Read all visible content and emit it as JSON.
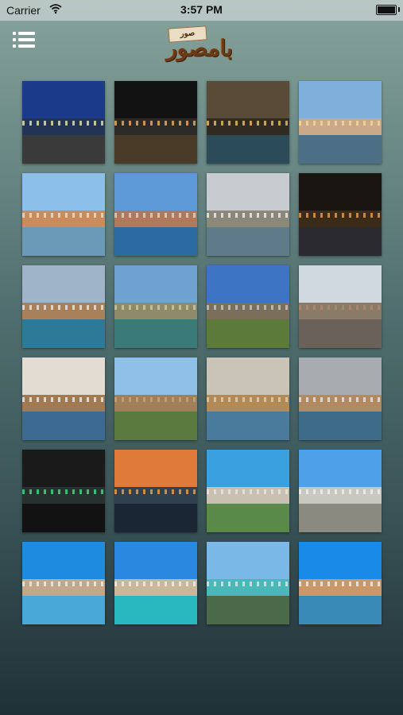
{
  "status_bar": {
    "carrier": "Carrier",
    "time": "3:57 PM"
  },
  "header": {
    "logo_main": "بامصور",
    "logo_tag": "صور"
  },
  "gallery": {
    "items": [
      {
        "sky": "#1c3a8a",
        "mid": "#233355",
        "low": "#3a3a3a",
        "lights": "#e9e6b0"
      },
      {
        "sky": "#121212",
        "mid": "#2b2a26",
        "low": "#4a3a28",
        "lights": "#f0b060"
      },
      {
        "sky": "#5a4a38",
        "mid": "#2f2a22",
        "low": "#2c4b58",
        "lights": "#f0c060"
      },
      {
        "sky": "#7fb0dc",
        "mid": "#c9a987",
        "low": "#4c6f86",
        "lights": "#f4d8a0"
      },
      {
        "sky": "#8cc0ea",
        "mid": "#c98c5a",
        "low": "#6a9ab8",
        "lights": "#e8e0d0"
      },
      {
        "sky": "#5e9ad8",
        "mid": "#b07a5a",
        "low": "#2c6aa4",
        "lights": "#e0d8c8"
      },
      {
        "sky": "#c8ccd0",
        "mid": "#8a8878",
        "low": "#5f7a88",
        "lights": "#f0f0f0"
      },
      {
        "sky": "#1a1510",
        "mid": "#3a2a18",
        "low": "#2a2a30",
        "lights": "#f0a040"
      },
      {
        "sky": "#9fb4c8",
        "mid": "#a8805a",
        "low": "#2c7a98",
        "lights": "#e8e8e8"
      },
      {
        "sky": "#6fa2d0",
        "mid": "#8f8a6a",
        "low": "#3a7a78",
        "lights": "#d0c8a0"
      },
      {
        "sky": "#3d74c4",
        "mid": "#7b6f5c",
        "low": "#5c7a3a",
        "lights": "#c8c8c8"
      },
      {
        "sky": "#d0d8e0",
        "mid": "#8a7a68",
        "low": "#6a625a",
        "lights": "#b08868"
      },
      {
        "sky": "#e2dcd2",
        "mid": "#a07a52",
        "low": "#3c6a90",
        "lights": "#f0f0f0"
      },
      {
        "sky": "#8fc0e8",
        "mid": "#a08058",
        "low": "#5a7a40",
        "lights": "#c0a880"
      },
      {
        "sky": "#c9c4b6",
        "mid": "#b28a58",
        "low": "#4a7a9c",
        "lights": "#e0d0b0"
      },
      {
        "sky": "#a8acb0",
        "mid": "#b08a62",
        "low": "#3e6b88",
        "lights": "#e8e8e8"
      },
      {
        "sky": "#1a1a1a",
        "mid": "#283030",
        "low": "#121212",
        "lights": "#40e080"
      },
      {
        "sky": "#e07a3a",
        "mid": "#30404e",
        "low": "#1a2634",
        "lights": "#f0a040"
      },
      {
        "sky": "#3aa0e0",
        "mid": "#c8c0b0",
        "low": "#5a8a4a",
        "lights": "#e8e8e8"
      },
      {
        "sky": "#4ea0e8",
        "mid": "#c8c8c0",
        "low": "#8a8a80",
        "lights": "#f0f0f0"
      },
      {
        "sky": "#1e8ae0",
        "mid": "#c0a888",
        "low": "#4aa8d8",
        "lights": "#f0f0f0"
      },
      {
        "sky": "#2a88e0",
        "mid": "#c8b898",
        "low": "#2ab8c0",
        "lights": "#f0f0f0"
      },
      {
        "sky": "#7ab8e8",
        "mid": "#4ab8b8",
        "low": "#4a6a4a",
        "lights": "#e8e8e8"
      },
      {
        "sky": "#1a8ae8",
        "mid": "#c89868",
        "low": "#3a8ab8",
        "lights": "#f0f0f0"
      }
    ]
  }
}
